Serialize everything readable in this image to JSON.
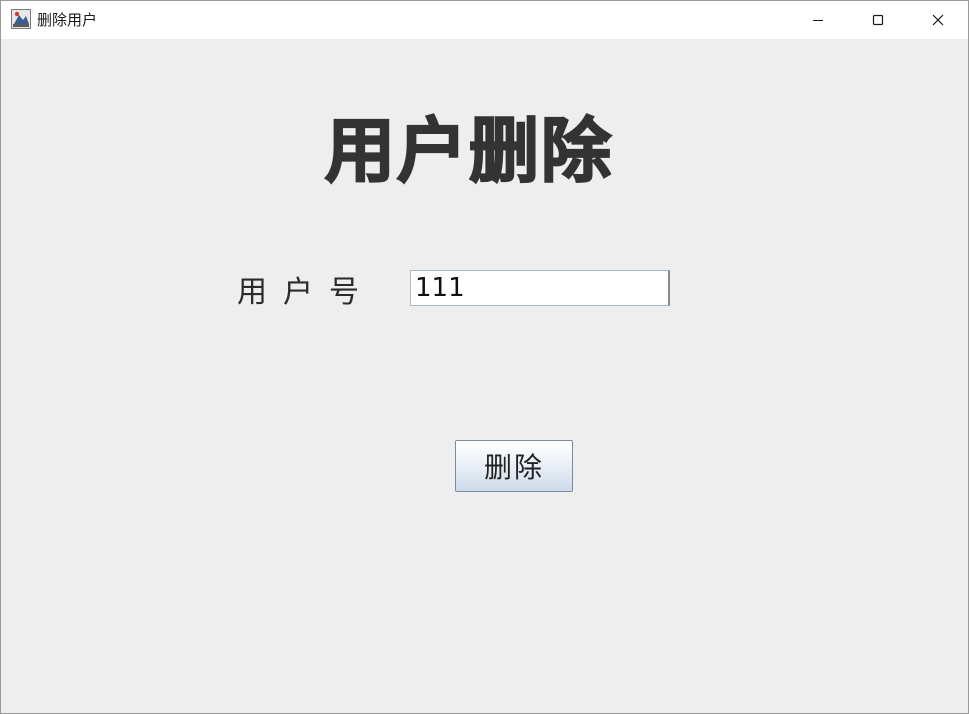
{
  "window": {
    "title": "删除用户",
    "controls": {
      "minimize_icon": "minimize-icon",
      "maximize_icon": "maximize-icon",
      "close_icon": "close-icon"
    }
  },
  "main": {
    "heading": "用户删除",
    "user_field": {
      "label": "用户号",
      "value": "111"
    },
    "delete_button": "删除"
  },
  "colors": {
    "background": "#eeeeee",
    "heading": "#333333",
    "button_gradient_bottom": "#cddbea"
  }
}
